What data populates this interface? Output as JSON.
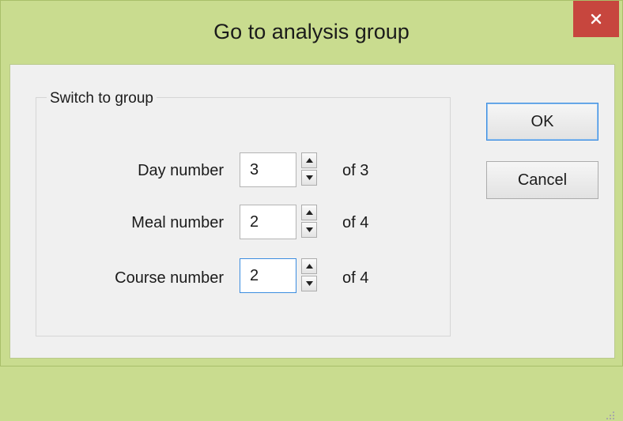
{
  "window": {
    "title": "Go to analysis group"
  },
  "group": {
    "caption": "Switch to group",
    "rows": [
      {
        "label": "Day number",
        "value": "3",
        "of": "of 3"
      },
      {
        "label": "Meal number",
        "value": "2",
        "of": "of 4"
      },
      {
        "label": "Course number",
        "value": "2",
        "of": "of 4"
      }
    ]
  },
  "buttons": {
    "ok": "OK",
    "cancel": "Cancel"
  },
  "colors": {
    "titlebar": "#c9dc8f",
    "close": "#c7463e",
    "focus": "#3c8de0"
  }
}
